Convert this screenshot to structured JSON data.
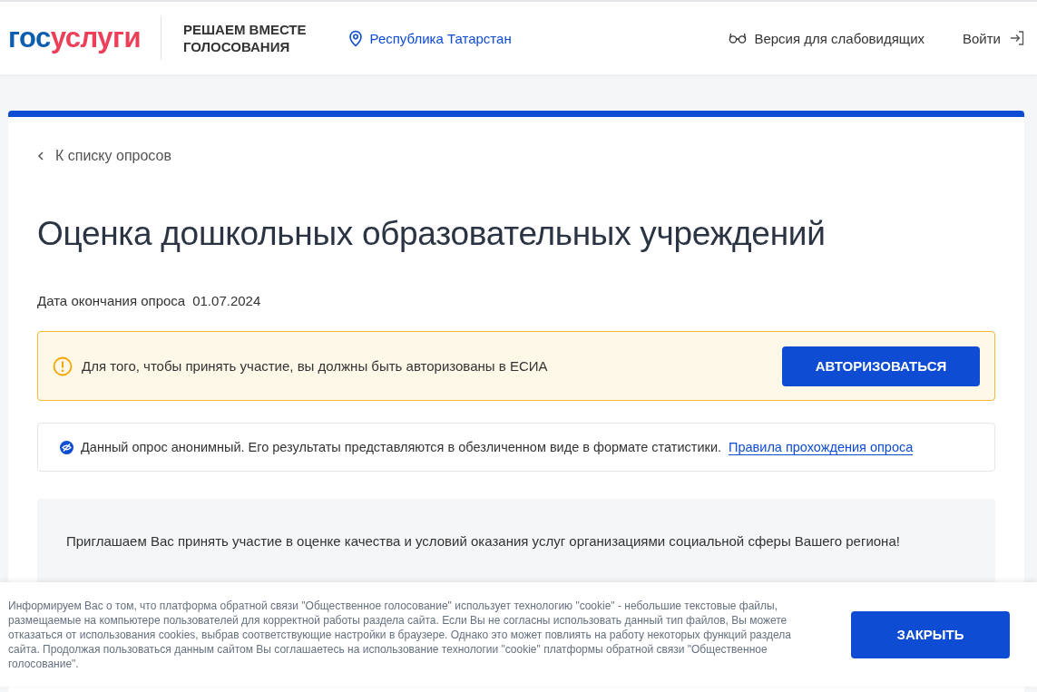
{
  "header": {
    "logo": {
      "first": "гос",
      "second": "услуги"
    },
    "project_title": "РЕШАЕМ ВМЕСТЕ\nГОЛОСОВАНИЯ",
    "region": "Республика Татарстан",
    "accessibility": "Версия для слабовидящих",
    "login": "Войти"
  },
  "back_link": "К списку опросов",
  "title": "Оценка дошкольных образовательных учреждений",
  "end_date": {
    "label": "Дата окончания опроса",
    "value": "01.07.2024"
  },
  "auth_notice": {
    "text": "Для того, чтобы принять участие, вы должны быть авторизованы в ЕСИА",
    "button": "АВТОРИЗОВАТЬСЯ"
  },
  "anon_notice": {
    "text": "Данный опрос анонимный. Его результаты представляются в обезличенном виде в формате статистики.",
    "link": "Правила прохождения опроса"
  },
  "intro": "Приглашаем Вас принять участие в оценке качества и условий оказания услуг организациями социальной сферы Вашего региона!",
  "cookie_banner": {
    "text": "Информируем Вас о том, что платформа обратной связи \"Общественное голосование\" использует технологию \"cookie\" - небольшие текстовые файлы, размещаемые на компьютере пользователей для корректной работы раздела сайта. Если Вы не согласны использовать данный тип файлов, Вы можете отказаться от использования cookies, выбрав соответствующие настройки в браузере. Однако это может повлиять на работу некоторых функций раздела сайта. Продолжая пользоваться данным сайтом Вы соглашаетесь на использование технологии \"cookie\" платформы обратной связи \"Общественное голосование\".",
    "button": "ЗАКРЫТЬ"
  }
}
